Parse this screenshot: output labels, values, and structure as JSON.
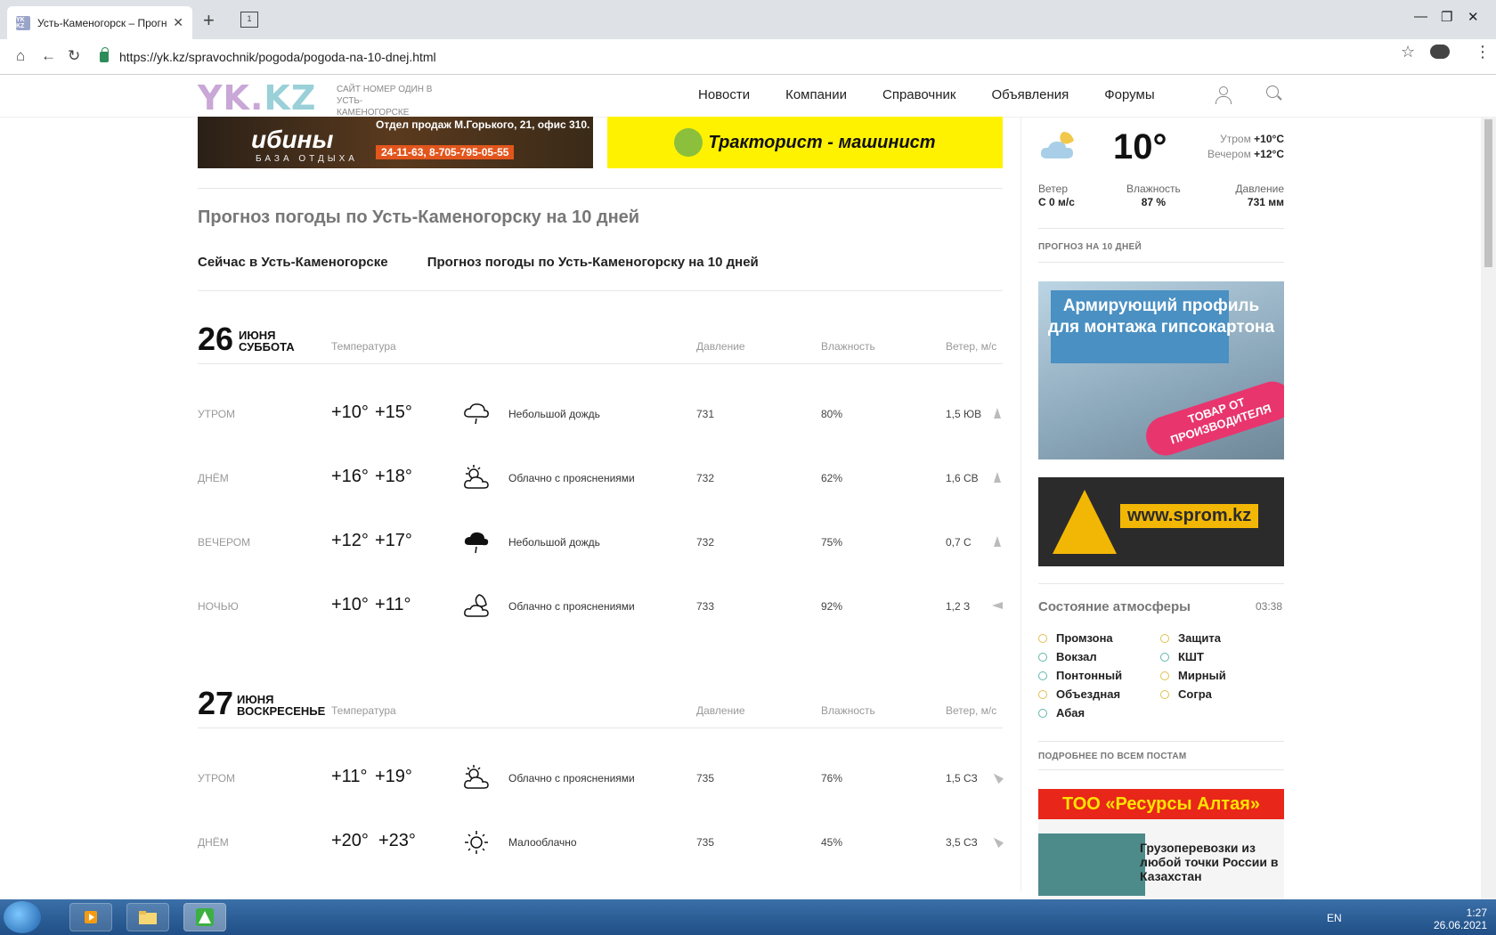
{
  "browser": {
    "tab_title": "Усть-Каменогорск – Прогноз",
    "favicon_text": "YK KZ",
    "new_tab": "+",
    "tab_group": "1",
    "url": "https://yk.kz/spravochnik/pogoda/pogoda-na-10-dnej.html"
  },
  "site": {
    "logo_a": "YK.",
    "logo_b": "KZ",
    "tagline": "САЙТ НОМЕР ОДИН В УСТЬ-КАМЕНОГОРСКЕ",
    "nav": [
      "Новости",
      "Компании",
      "Справочник",
      "Объявления",
      "Форумы"
    ]
  },
  "banners": {
    "left_big": "ибины",
    "left_small": "БАЗА ОТДЫХА",
    "left_addr": "Отдел продаж М.Горького, 21, офис 310.",
    "left_phone": "24-11-63, 8-705-795-05-55",
    "right": "Тракторист - машинист"
  },
  "page": {
    "title": "Прогноз погоды по Усть-Каменогорску на 10 дней",
    "tabs": [
      "Сейчас в Усть-Каменогорске",
      "Прогноз погоды по Усть-Каменогорску на 10 дней"
    ],
    "columns": {
      "temp": "Температура",
      "pressure": "Давление",
      "humidity": "Влажность",
      "wind": "Ветер, м/с"
    }
  },
  "days": [
    {
      "num": "26",
      "month": "ИЮНЯ",
      "weekday": "СУББОТА",
      "rows": [
        {
          "part": "УТРОМ",
          "t1": "+10°",
          "t2": "+15°",
          "icon": "rain-cloud-icon",
          "desc": "Небольшой дождь",
          "pressure": "731",
          "humidity": "80%",
          "wind": "1,5 ЮВ"
        },
        {
          "part": "ДНЁМ",
          "t1": "+16°",
          "t2": "+18°",
          "icon": "partly-cloudy-icon",
          "desc": "Облачно с прояснениями",
          "pressure": "732",
          "humidity": "62%",
          "wind": "1,6 СВ"
        },
        {
          "part": "ВЕЧЕРОМ",
          "t1": "+12°",
          "t2": "+17°",
          "icon": "heavy-rain-icon",
          "desc": "Небольшой дождь",
          "pressure": "732",
          "humidity": "75%",
          "wind": "0,7 С"
        },
        {
          "part": "НОЧЬЮ",
          "t1": "+10°",
          "t2": "+11°",
          "icon": "night-cloud-icon",
          "desc": "Облачно с прояснениями",
          "pressure": "733",
          "humidity": "92%",
          "wind": "1,2 З"
        }
      ]
    },
    {
      "num": "27",
      "month": "ИЮНЯ",
      "weekday": "ВОСКРЕСЕНЬЕ",
      "rows": [
        {
          "part": "УТРОМ",
          "t1": "+11°",
          "t2": "+19°",
          "icon": "partly-cloudy-icon",
          "desc": "Облачно с прояснениями",
          "pressure": "735",
          "humidity": "76%",
          "wind": "1,5 СЗ"
        },
        {
          "part": "ДНЁМ",
          "t1": "+20°",
          "t2": "+23°",
          "icon": "sun-icon",
          "desc": "Малооблачно",
          "pressure": "735",
          "humidity": "45%",
          "wind": "3,5 СЗ"
        }
      ]
    }
  ],
  "sidebar": {
    "now_temp": "10°",
    "morning_label": "Утром",
    "morning_val": "+10°C",
    "evening_label": "Вечером",
    "evening_val": "+12°C",
    "wind_label": "Ветер",
    "wind_val": "С 0 м/с",
    "humidity_label": "Влажность",
    "humidity_val": "87 %",
    "pressure_label": "Давление",
    "pressure_val": "731 мм",
    "forecast_link": "ПРОГНОЗ НА 10 ДНЕЙ",
    "ad1_text": "Армирующий профиль для монтажа гипсокартона",
    "ad1_badge": "ТОВАР ОТ ПРОИЗВОДИТЕЛЯ",
    "ad2_url": "www.sprom.kz",
    "atm_title": "Состояние атмосферы",
    "atm_time": "03:38",
    "atm_left": [
      "Промзона",
      "Вокзал",
      "Понтонный",
      "Объездная",
      "Абая"
    ],
    "atm_right": [
      "Защита",
      "КШТ",
      "Мирный",
      "Согра"
    ],
    "more_link": "ПОДРОБНЕЕ ПО ВСЕМ ПОСТАМ",
    "ad3_header": "ТОО «Ресурсы Алтая»",
    "ad3_text": "Грузоперевозки из любой точки России в Казахстан"
  },
  "taskbar": {
    "lang": "EN",
    "time": "1:27",
    "date": "26.06.2021"
  }
}
